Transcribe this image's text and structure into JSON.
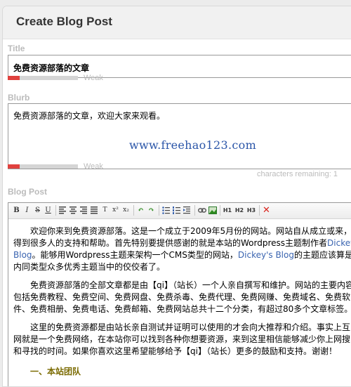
{
  "header": {
    "title": "Create Blog Post"
  },
  "title_field": {
    "label": "Title",
    "value": "免费资源部落的文章",
    "strength": 0.17,
    "strength_label": "Weak"
  },
  "blurb_field": {
    "label": "Blurb",
    "value": "免费资源部落的文章，欢迎大家来观看。",
    "url": "www.freehao123.com",
    "strength": 0.17,
    "strength_label": "Weak",
    "chars_remaining": "characters remaining: 1"
  },
  "post_field": {
    "label": "Blog Post",
    "toolbar": {
      "bold": "B",
      "italic": "I",
      "strike": "S",
      "underline": "U",
      "superscript": "x²",
      "subscript": "x₂",
      "h1": "H1",
      "h2": "H2",
      "h3": "H3",
      "icons": [
        "align-left-icon",
        "align-center-icon",
        "align-right-icon",
        "justify-icon",
        "clear-format-icon",
        "undo-icon",
        "redo-icon",
        "bullet-list-icon",
        "numbered-list-icon",
        "outdent-icon",
        "link-icon",
        "image-icon",
        "remove-icon"
      ]
    },
    "content": {
      "p1": [
        "欢迎你来到免费资源部落。这是一个成立于2009年5月份的网站。网站自从成立或来，",
        "得到很多人的支持和帮助。首先特别要提供感谢的就是本站的Wordpress主题制作者",
        "Blog",
        "。能够用Wordpress主题来架构一个CMS类型的网站，",
        "Dickey's Blog",
        "的主题应该算是",
        "内同类型众多优秀主题当中的佼佼者了。"
      ],
      "p1_link_tail": "Dickey",
      "p2": [
        "免费资源部落的全部文章都是由【qi】（站长）一个人亲自撰写和维护。网站的主要内容",
        "包括免费教程、免费空间、免费网盘、免费杀毒、免费代理、免费网赚、免费域名、免费软",
        "件、免费相册、免费电话、免费邮箱、免费网站总共十二个分类，有超过80多个文章标签。"
      ],
      "p3": [
        "这里的免费资源都是由站长亲自测试并证明可以使用的才会向大推荐和介绍。事实上互",
        "网就是一个免费网络，在本站你可以找到各种你想要资源，来到这里相信能够减少你上网搜",
        "和寻找的时间。如果你喜欢这里希望能够给予【qi】（站长）更多的鼓励和支持。谢谢！"
      ],
      "heading": "一、本站团队"
    }
  }
}
